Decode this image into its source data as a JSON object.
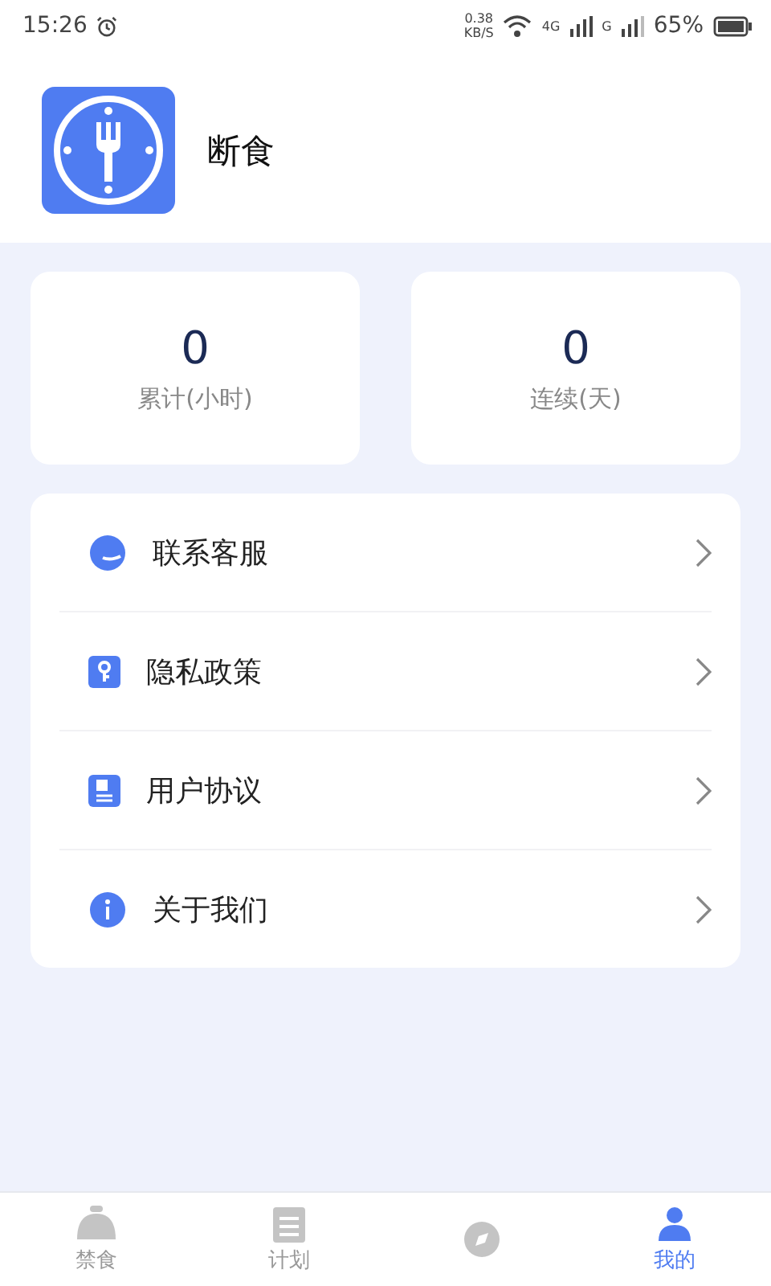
{
  "status_bar": {
    "time": "15:26",
    "speed": "0.38",
    "speed_unit": "KB/S",
    "network": "4G",
    "network2": "G",
    "battery": "65%"
  },
  "profile": {
    "name": "断食"
  },
  "stats": [
    {
      "value": "0",
      "label": "累计(小时)"
    },
    {
      "value": "0",
      "label": "连续(天)"
    }
  ],
  "menu": [
    {
      "kind": "service",
      "label": "联系客服"
    },
    {
      "kind": "privacy",
      "label": "隐私政策"
    },
    {
      "kind": "agreement",
      "label": "用户协议"
    },
    {
      "kind": "about",
      "label": "关于我们"
    }
  ],
  "tabs": [
    {
      "kind": "fast",
      "label": "禁食",
      "selected": false
    },
    {
      "kind": "plan",
      "label": "计划",
      "selected": false
    },
    {
      "kind": "discover",
      "selected": false
    },
    {
      "kind": "mine",
      "label": "我的",
      "selected": true
    }
  ]
}
